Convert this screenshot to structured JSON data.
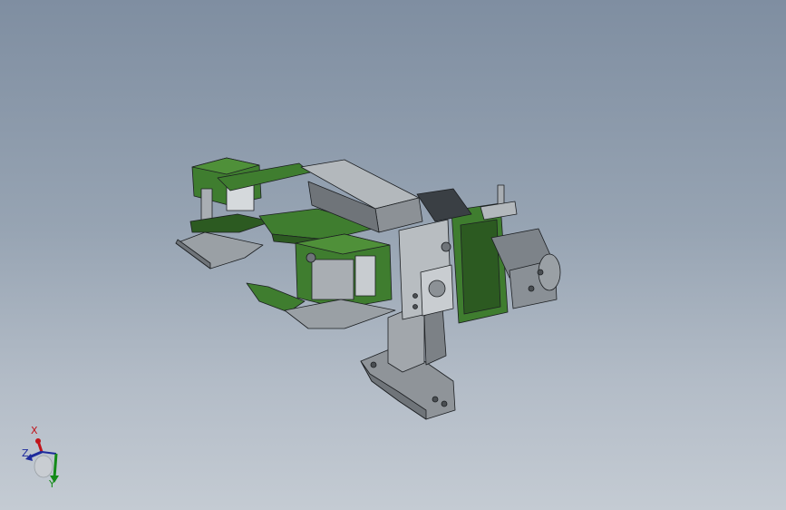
{
  "viewport": {
    "background_top": "#7f8ea1",
    "background_bottom": "#c4cbd3"
  },
  "model": {
    "colors": {
      "green_plate": "#3f7d2f",
      "green_dark": "#2c5a21",
      "steel": "#a9aeb3",
      "steel_dark": "#6f7479",
      "motor": "#8a9096",
      "edge": "#1c1f22"
    }
  },
  "triad": {
    "x_label": "X",
    "z_label": "Z",
    "y_label": "Y",
    "colors": {
      "x": "#c0141a",
      "y": "#138a18",
      "z": "#1d2a9c"
    }
  }
}
